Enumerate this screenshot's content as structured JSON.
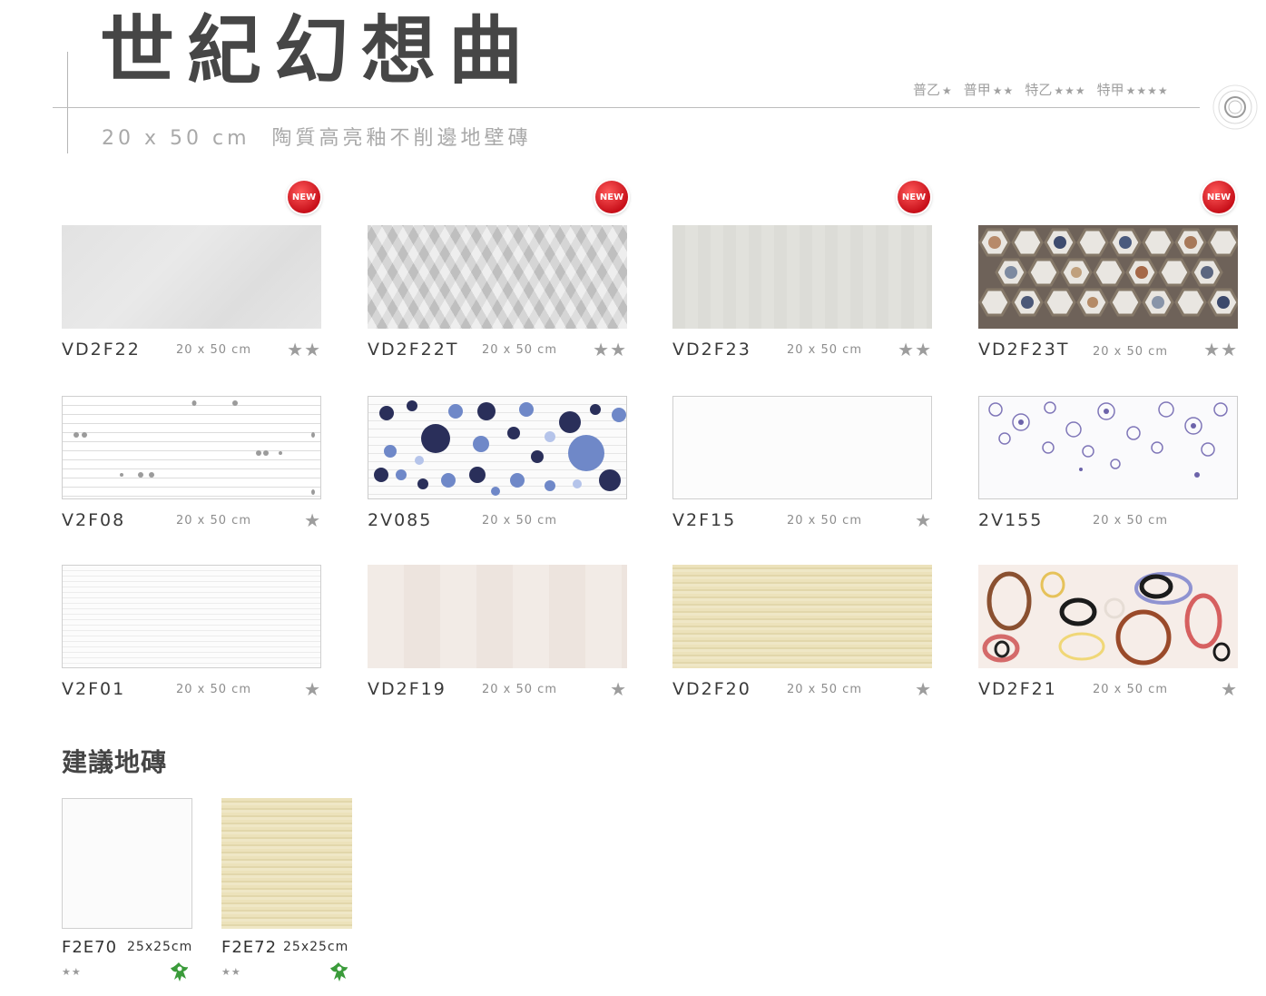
{
  "header": {
    "title": "世紀幻想曲",
    "size": "20 x 50 cm",
    "description": "陶質高亮釉不削邊地壁磚",
    "grades": [
      {
        "label": "普乙",
        "stars": "★"
      },
      {
        "label": "普甲",
        "stars": "★★"
      },
      {
        "label": "特乙",
        "stars": "★★★"
      },
      {
        "label": "特甲",
        "stars": "★★★★"
      }
    ]
  },
  "badge_text": "NEW",
  "tiles": [
    {
      "code": "VD2F22",
      "size": "20 x 50 cm",
      "stars": "★★",
      "new": true
    },
    {
      "code": "VD2F22T",
      "size": "20 x 50 cm",
      "stars": "★★",
      "new": true
    },
    {
      "code": "VD2F23",
      "size": "20 x 50 cm",
      "stars": "★★",
      "new": true
    },
    {
      "code": "VD2F23T",
      "size": "20 x 50 cm",
      "stars": "★★",
      "new": true
    },
    {
      "code": "V2F08",
      "size": "20 x 50 cm",
      "stars": "★"
    },
    {
      "code": "2V085",
      "size": "20 x 50 cm",
      "stars": ""
    },
    {
      "code": "V2F15",
      "size": "20 x 50 cm",
      "stars": "★"
    },
    {
      "code": "2V155",
      "size": "20 x 50 cm",
      "stars": ""
    },
    {
      "code": "V2F01",
      "size": "20 x 50 cm",
      "stars": "★"
    },
    {
      "code": "VD2F19",
      "size": "20 x 50 cm",
      "stars": "★"
    },
    {
      "code": "VD2F20",
      "size": "20 x 50 cm",
      "stars": "★"
    },
    {
      "code": "VD2F21",
      "size": "20 x 50 cm",
      "stars": "★"
    }
  ],
  "suggested": {
    "title": "建議地磚",
    "items": [
      {
        "code": "F2E70",
        "size": "25x25cm",
        "stars": "★★"
      },
      {
        "code": "F2E72",
        "size": "25x25cm",
        "stars": "★★"
      }
    ]
  }
}
